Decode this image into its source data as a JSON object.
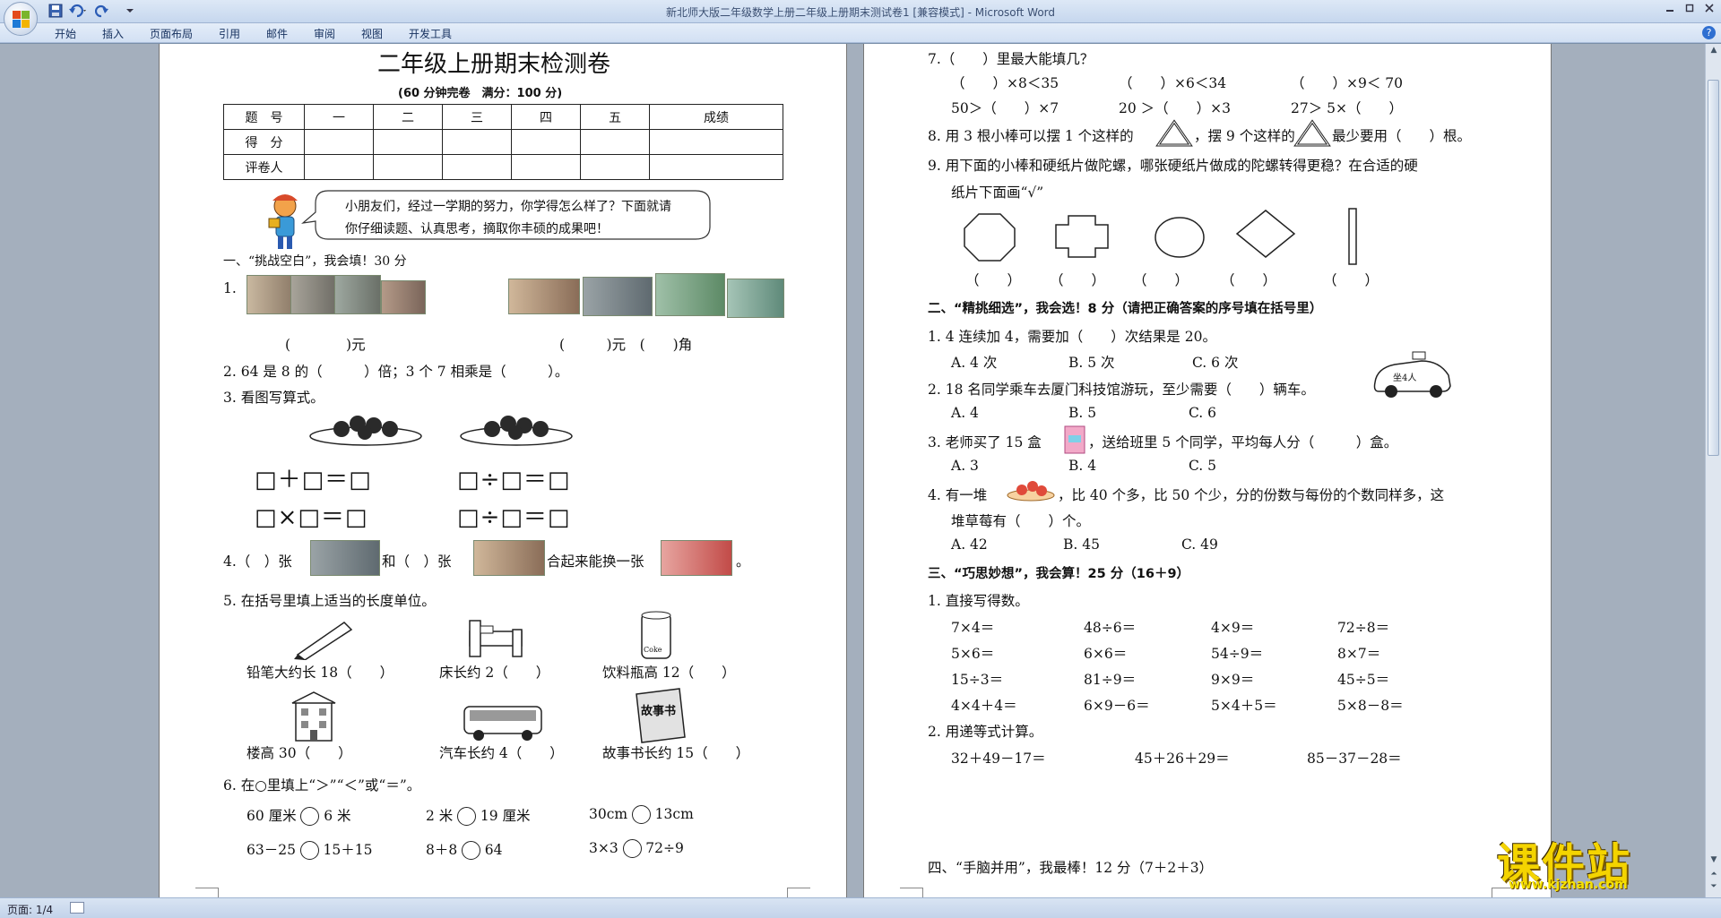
{
  "window": {
    "title": "新北师大版二年级数学上册二年级上册期末测试卷1 [兼容模式] - Microsoft Word",
    "quick_access": [
      "save-icon",
      "undo-icon",
      "redo-icon"
    ],
    "controls": [
      "minimize-icon",
      "maximize-icon",
      "close-icon"
    ]
  },
  "ribbon": {
    "tabs": [
      "开始",
      "插入",
      "页面布局",
      "引用",
      "邮件",
      "审阅",
      "视图",
      "开发工具"
    ]
  },
  "statusbar": {
    "page": "页面: 1/4"
  },
  "watermark": {
    "main": "课件站",
    "url": "www.kjzhan.com"
  },
  "page1": {
    "title": "二年级上册期末检测卷",
    "subtitle": "(60 分钟完卷　满分：100 分)",
    "score_table": {
      "header": [
        "题　号",
        "一",
        "二",
        "三",
        "四",
        "五",
        "成绩"
      ],
      "rows": [
        "得　分",
        "评卷人"
      ]
    },
    "greeting": "小朋友们，经过一学期的努力，你学得怎么样了？下面就请你仔细读题、认真思考，摘取你丰硕的成果吧！",
    "greeting_line1": "小朋友们，经过一学期的努力，你学得怎么样了？下面就请",
    "greeting_line2": "你仔细读题、认真思考，摘取你丰硕的成果吧！",
    "section1": "一、“挑战空白”，我会填！30 分",
    "q1_num": "1.",
    "q1_answer_left": "(　　　　)元",
    "q1_answer_right": "(　　　)元　(　　)角",
    "q2": "2. 64 是 8 的（　　　）倍；3 个 7 相乘是（　　　）。",
    "q3": "3. 看图写算式。",
    "q3_eq": [
      "□＋□＝□",
      "□÷□＝□",
      "□×□＝□",
      "□÷□＝□"
    ],
    "q4_a": "4.（　）张",
    "q4_b": "和（　）张",
    "q4_c": "合起来能换一张",
    "q4_d": "。",
    "q5": "5. 在括号里填上适当的长度单位。",
    "q5_items": [
      "铅笔大约长 18（　　）",
      "床长约 2（　　）",
      "饮料瓶高 12（　　）",
      "楼高 30（　　）",
      "汽车长约 4（　　）",
      "故事书长约 15（　　）"
    ],
    "coke": "Coke",
    "story_book": "故事书",
    "q6": "6. 在○里填上“＞”“＜”或“＝”。",
    "q6_rows": [
      [
        "60 厘米",
        "6 米",
        "2 米",
        "19 厘米",
        "30cm",
        "13cm"
      ],
      [
        "63－25",
        "15＋15",
        "8＋8",
        "64",
        "3×3",
        "72÷9"
      ]
    ]
  },
  "page2": {
    "q7": "7.（　　）里最大能填几？",
    "q7_row1": [
      "（　　）×8＜35",
      "（　　）×6＜34",
      "（　　）×9＜ 70"
    ],
    "q7_row2": [
      "50＞（　　）×7",
      "20 ＞（　　）×3",
      "27＞ 5×（　　）"
    ],
    "q8_a": "8. 用 3 根小棒可以摆 1 个这样的",
    "q8_b": "，摆 9 个这样的",
    "q8_c": "最少要用（　　）根。",
    "q9_line1": "9. 用下面的小棒和硬纸片做陀螺，哪张硬纸片做成的陀螺转得更稳？在合适的硬",
    "q9_line2": "纸片下面画“√”",
    "q9_blanks": [
      "（　　）",
      "（　　）",
      "（　　）",
      "（　　）",
      "（　　）"
    ],
    "section2": "二、“精挑细选”，我会选！8 分（请把正确答案的序号填在括号里）",
    "s2_q1": "1. 4 连续加 4，需要加（　　）次结果是 20。",
    "s2_q1_opts": [
      "A. 4 次",
      "B. 5 次",
      "C. 6 次"
    ],
    "s2_q2": "2. 18 名同学乘车去厦门科技馆游玩，至少需要（　　）辆车。",
    "taxi_label": "坐4人",
    "s2_q2_opts": [
      "A. 4",
      "B. 5",
      "C. 6"
    ],
    "s2_q3_a": "3. 老师买了 15 盒",
    "s2_q3_b": "，送给班里 5 个同学，平均每人分（　　　）盒。",
    "s2_q3_opts": [
      "A. 3",
      "B. 4",
      "C. 5"
    ],
    "s2_q4_a": "4. 有一堆",
    "s2_q4_b": "，比 40 个多，比 50 个少，分的份数与每份的个数同样多，这",
    "s2_q4_line2": "堆草莓有（　　）个。",
    "s2_q4_opts": [
      "A. 42",
      "B. 45",
      "C. 49"
    ],
    "section3": "三、“巧思妙想”，我会算！25 分（16＋9）",
    "s3_q1": "1. 直接写得数。",
    "s3_grid": [
      [
        "7×4＝",
        "48÷6＝",
        "4×9＝",
        "72÷8＝"
      ],
      [
        "5×6＝",
        "6×6＝",
        "54÷9＝",
        "8×7＝"
      ],
      [
        "15÷3＝",
        "81÷9＝",
        "9×9＝",
        "45÷5＝"
      ],
      [
        "4×4＋4＝",
        "6×9－6＝",
        "5×4＋5＝",
        "5×8－8＝"
      ]
    ],
    "s3_q2": "2. 用递等式计算。",
    "s3_q2_items": [
      "32＋49－17＝",
      "45＋26＋29＝",
      "85－37－28＝"
    ],
    "section4": "四、“手脑并用”，我最棒！12 分（7＋2＋3）"
  }
}
